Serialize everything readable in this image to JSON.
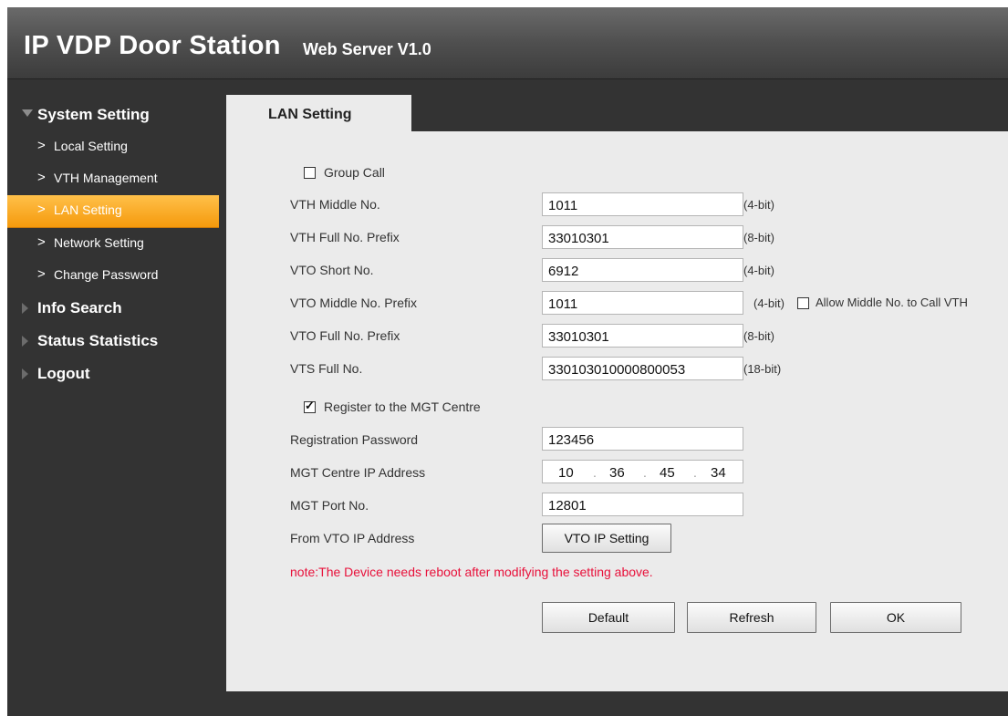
{
  "header": {
    "title": "IP VDP Door Station",
    "subtitle": "Web Server V1.0"
  },
  "sidebar": {
    "groups": [
      {
        "label": "System Setting",
        "expanded": true,
        "items": [
          {
            "label": "Local Setting"
          },
          {
            "label": "VTH Management"
          },
          {
            "label": "LAN Setting",
            "active": true
          },
          {
            "label": "Network Setting"
          },
          {
            "label": "Change Password"
          }
        ]
      },
      {
        "label": "Info Search",
        "expanded": false
      },
      {
        "label": "Status Statistics",
        "expanded": false
      },
      {
        "label": "Logout",
        "expanded": false
      }
    ]
  },
  "tab": {
    "label": "LAN Setting"
  },
  "form": {
    "group_call": {
      "label": "Group Call",
      "checked": false
    },
    "vth_middle_no": {
      "label": "VTH Middle No.",
      "value": "1011",
      "hint": "(4-bit)"
    },
    "vth_full_prefix": {
      "label": "VTH Full No. Prefix",
      "value": "33010301",
      "hint": "(8-bit)"
    },
    "vto_short_no": {
      "label": "VTO Short No.",
      "value": "6912",
      "hint": "(4-bit)"
    },
    "vto_middle_prefix": {
      "label": "VTO Middle No. Prefix",
      "value": "1011",
      "hint": "(4-bit)",
      "allow_label": "Allow Middle No. to Call VTH",
      "allow_checked": false
    },
    "vto_full_prefix": {
      "label": "VTO Full No. Prefix",
      "value": "33010301",
      "hint": "(8-bit)"
    },
    "vts_full_no": {
      "label": "VTS Full No.",
      "value": "330103010000800053",
      "hint": "(18-bit)"
    },
    "register_mgt": {
      "label": "Register to the MGT Centre",
      "checked": true
    },
    "reg_password": {
      "label": "Registration Password",
      "value": "123456"
    },
    "mgt_ip": {
      "label": "MGT Centre IP Address",
      "octets": [
        "10",
        "36",
        "45",
        "34"
      ]
    },
    "mgt_port": {
      "label": "MGT Port No.",
      "value": "12801"
    },
    "vto_ip": {
      "label": "From VTO IP Address",
      "button": "VTO IP Setting"
    },
    "note": "note:The Device needs reboot after modifying the setting above."
  },
  "buttons": {
    "default": "Default",
    "refresh": "Refresh",
    "ok": "OK"
  },
  "colors": {
    "active_menu": "#f7a21b",
    "note": "#e8103a",
    "panel": "#ebebeb",
    "background": "#333333"
  },
  "icons": {
    "expanded": "triangle-down-icon",
    "collapsed": "triangle-right-icon",
    "menu_item": "chevron-right-icon"
  }
}
